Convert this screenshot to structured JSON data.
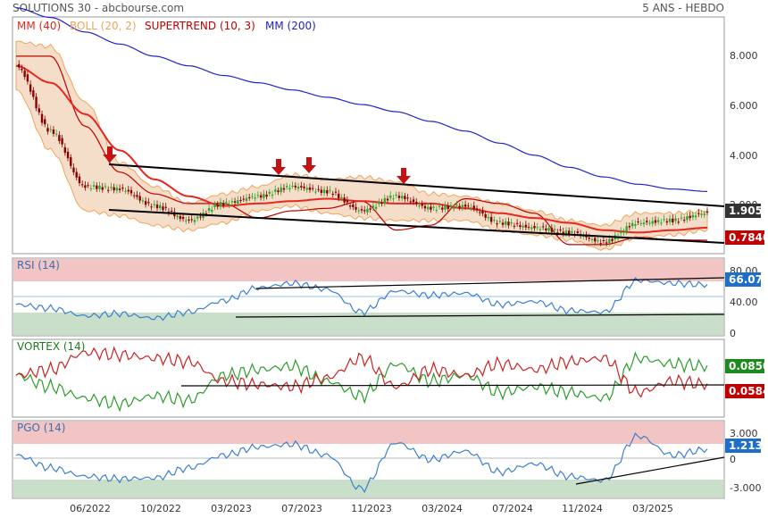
{
  "header": {
    "source": "SOLUTIONS 30 - abcbourse.com",
    "period": "5 ANS - HEBDO"
  },
  "colors": {
    "mm40": "#e8261d",
    "boll": "#f0a55a",
    "boll_fill": "#f3d6bc",
    "supertrend": "#c00000",
    "mm200": "#2222cc",
    "candle_up": "#2fa82f",
    "candle_down": "#8b0000",
    "rsi": "#3d7fd0",
    "vortex_plus": "#2a9d2a",
    "vortex_minus": "#cc2222",
    "pgo": "#3d7fd0",
    "zone_high": "#f2c4c4",
    "zone_low": "#c9dfc9",
    "badge_blue": "#1f6ec7",
    "badge_green": "#1e8a1e",
    "badge_red": "#c00000",
    "badge_dark": "#333333",
    "arrow": "#c41111"
  },
  "x_labels": [
    "06/2022",
    "10/2022",
    "03/2023",
    "07/2023",
    "11/2023",
    "03/2024",
    "07/2024",
    "11/2024",
    "03/2025"
  ],
  "chart_data": [
    {
      "type": "line",
      "panel": "price",
      "legend": [
        "MM (40)",
        "BOLL (20, 2)",
        "SUPERTREND (10, 3)",
        "MM (200)"
      ],
      "y_ticks": [
        "8.000",
        "6.000",
        "4.000",
        "2.000"
      ],
      "ylim": [
        0.3,
        9.8
      ],
      "last_price": "1.905",
      "supertrend_last": "0.7840",
      "x": [
        "2022-02",
        "2022-04",
        "2022-06",
        "2022-08",
        "2022-10",
        "2022-12",
        "2023-02",
        "2023-04",
        "2023-06",
        "2023-08",
        "2023-10",
        "2023-12",
        "2024-02",
        "2024-04",
        "2024-06",
        "2024-08",
        "2024-10",
        "2024-12",
        "2025-02",
        "2025-04",
        "2025-06"
      ],
      "series": [
        {
          "name": "Close",
          "values": [
            8.0,
            5.3,
            3.0,
            2.9,
            2.2,
            1.6,
            2.3,
            2.6,
            3.0,
            2.8,
            2.0,
            2.6,
            2.1,
            2.2,
            1.5,
            1.3,
            1.1,
            0.7,
            1.5,
            1.6,
            1.9
          ]
        },
        {
          "name": "MM (40)",
          "values": [
            8.0,
            7.3,
            6.0,
            4.5,
            3.3,
            2.6,
            2.2,
            2.3,
            2.4,
            2.5,
            2.4,
            2.3,
            2.3,
            2.1,
            1.9,
            1.7,
            1.5,
            1.2,
            1.1,
            1.2,
            1.3
          ]
        },
        {
          "name": "MM (200)",
          "values": [
            10.4,
            10.0,
            9.4,
            8.9,
            8.4,
            8.0,
            7.6,
            7.3,
            7.0,
            6.7,
            6.4,
            6.1,
            5.7,
            5.3,
            4.8,
            4.3,
            3.8,
            3.4,
            3.1,
            2.9,
            2.8
          ]
        },
        {
          "name": "SUPERTREND (10, 3)",
          "values": [
            8.4,
            8.4,
            5.5,
            3.6,
            2.7,
            2.3,
            2.3,
            1.7,
            2.0,
            2.1,
            2.4,
            1.2,
            1.4,
            2.5,
            2.3,
            1.9,
            0.6,
            0.6,
            0.9,
            0.8,
            0.78
          ]
        },
        {
          "name": "BOLL upper",
          "values": [
            9.0,
            8.8,
            6.5,
            4.0,
            3.0,
            2.3,
            2.7,
            3.0,
            3.5,
            3.3,
            3.4,
            3.2,
            2.7,
            2.6,
            2.3,
            2.0,
            1.6,
            1.4,
            1.9,
            1.9,
            2.0
          ]
        },
        {
          "name": "BOLL lower",
          "values": [
            7.0,
            4.5,
            2.0,
            1.8,
            1.4,
            1.2,
            1.5,
            2.0,
            2.2,
            1.9,
            1.7,
            1.6,
            1.6,
            1.6,
            1.2,
            1.0,
            0.8,
            0.4,
            0.9,
            1.0,
            1.2
          ]
        }
      ]
    },
    {
      "type": "line",
      "panel": "rsi",
      "legend": [
        "RSI (14)"
      ],
      "y_ticks": [
        "80.00",
        "40.00",
        "0"
      ],
      "ylim": [
        0,
        100
      ],
      "last_value": "66.07",
      "x": [
        "2022-02",
        "2022-04",
        "2022-06",
        "2022-08",
        "2022-10",
        "2022-12",
        "2023-02",
        "2023-04",
        "2023-06",
        "2023-08",
        "2023-10",
        "2023-12",
        "2024-02",
        "2024-04",
        "2024-06",
        "2024-08",
        "2024-10",
        "2024-12",
        "2025-02",
        "2025-04",
        "2025-06"
      ],
      "series": [
        {
          "name": "RSI (14)",
          "values": [
            40,
            35,
            25,
            28,
            22,
            30,
            45,
            62,
            68,
            60,
            30,
            58,
            52,
            55,
            40,
            44,
            32,
            30,
            72,
            68,
            66
          ]
        }
      ]
    },
    {
      "type": "line",
      "panel": "vortex",
      "legend": [
        "VORTEX (14)"
      ],
      "last_plus": "0.0850",
      "last_minus": "0.0584",
      "x": [
        "2022-02",
        "2022-04",
        "2022-06",
        "2022-08",
        "2022-10",
        "2022-12",
        "2023-02",
        "2023-04",
        "2023-06",
        "2023-08",
        "2023-10",
        "2023-12",
        "2024-02",
        "2024-04",
        "2024-06",
        "2024-08",
        "2024-10",
        "2024-12",
        "2025-02",
        "2025-04",
        "2025-06"
      ],
      "series": [
        {
          "name": "VI+",
          "values": [
            1.0,
            0.9,
            0.8,
            0.75,
            0.82,
            0.78,
            1.0,
            1.05,
            1.08,
            0.95,
            0.82,
            1.1,
            0.95,
            1.0,
            0.85,
            0.9,
            0.85,
            0.8,
            1.15,
            1.1,
            1.08
          ]
        },
        {
          "name": "VI-",
          "values": [
            1.0,
            1.05,
            1.2,
            1.18,
            1.15,
            1.12,
            0.95,
            0.92,
            0.9,
            0.98,
            1.15,
            0.9,
            1.05,
            1.0,
            1.1,
            1.05,
            1.12,
            1.15,
            0.85,
            0.95,
            0.92
          ]
        }
      ]
    },
    {
      "type": "line",
      "panel": "pgo",
      "legend": [
        "PGO (14)"
      ],
      "y_ticks": [
        "3.000",
        "0",
        "-3.000"
      ],
      "ylim": [
        -4.5,
        4.5
      ],
      "last_value": "1.213",
      "x": [
        "2022-02",
        "2022-04",
        "2022-06",
        "2022-08",
        "2022-10",
        "2022-12",
        "2023-02",
        "2023-04",
        "2023-06",
        "2023-08",
        "2023-10",
        "2023-12",
        "2024-02",
        "2024-04",
        "2024-06",
        "2024-08",
        "2024-10",
        "2024-12",
        "2025-02",
        "2025-04",
        "2025-06"
      ],
      "series": [
        {
          "name": "PGO (14)",
          "values": [
            0.5,
            -1.0,
            -2.0,
            -2.3,
            -2.2,
            -1.0,
            0.5,
            1.5,
            1.8,
            0.5,
            -3.5,
            2.0,
            0.0,
            1.0,
            -1.5,
            -0.5,
            -2.0,
            -2.5,
            2.8,
            0.5,
            1.2
          ]
        }
      ]
    }
  ]
}
